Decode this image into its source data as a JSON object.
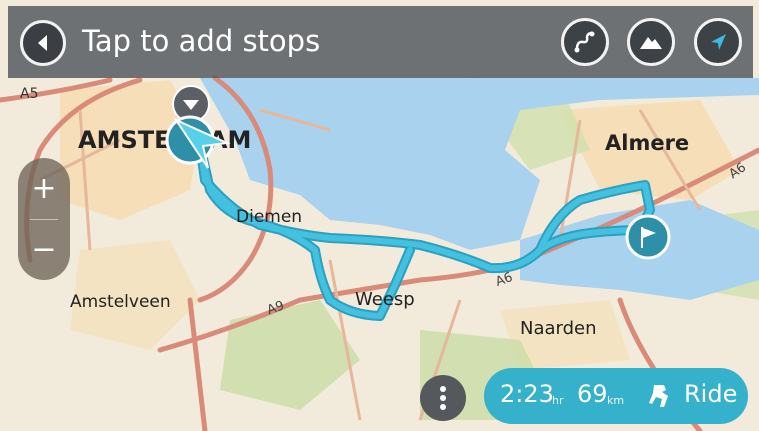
{
  "header": {
    "title": "Tap to add stops"
  },
  "toolbar": {
    "back_icon": "back-arrow-icon",
    "route_icon": "route-icon",
    "hill_icon": "mountain-icon",
    "nav_icon": "navigation-arrow-icon"
  },
  "zoom": {
    "in_label": "+",
    "out_label": "−"
  },
  "map": {
    "labels": {
      "a5": "A5",
      "amsterdam": "AMSTERDAM",
      "almere": "Almere",
      "a6_top": "A6",
      "diemen": "Diemen",
      "amstelveen": "Amstelveen",
      "weesp": "Weesp",
      "a9": "A9",
      "a6_mid": "A6",
      "naarden": "Naarden"
    },
    "colors": {
      "land": "#f2ebdc",
      "water": "#a8d2ee",
      "green": "#c9dca6",
      "road_major": "#d98a78",
      "route": "#43c1e0",
      "marker": "#2d8fa8"
    }
  },
  "route_summary": {
    "time_value": "2:23",
    "time_unit": "hr",
    "distance_value": "69",
    "distance_unit": "km",
    "action_label": "Ride",
    "action_icon": "motorcycle-icon"
  },
  "more_button": {
    "icon": "more-vertical-icon"
  }
}
